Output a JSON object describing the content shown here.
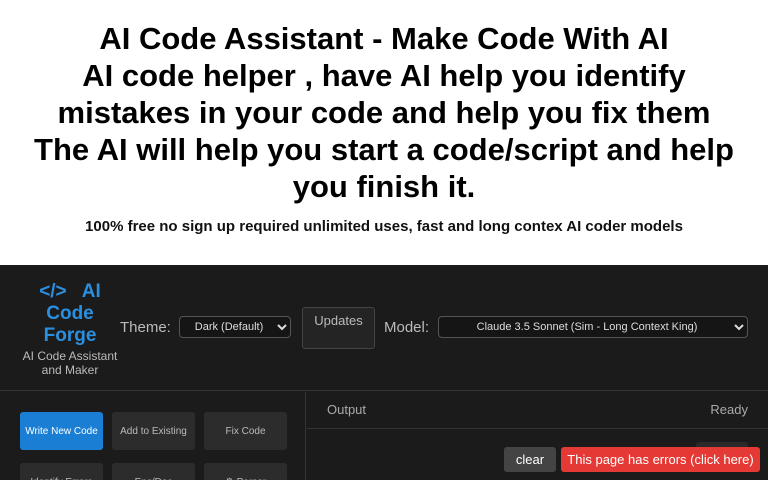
{
  "hero": {
    "title_lines": [
      "AI Code Assistant - Make Code With AI",
      "AI code helper , have AI help you identify",
      "mistakes in your code and help you fix them",
      "The AI will help you start a code/script and help",
      "you finish it."
    ],
    "tagline": "100% free no sign up required unlimited uses, fast and long contex AI coder models"
  },
  "brand": {
    "logo_lines": [
      "</>   AI",
      "Code",
      "Forge"
    ],
    "subtitle": "AI Code Assistant and Maker"
  },
  "toolbar": {
    "theme_label": "Theme:",
    "theme_value": " Dark (Default)",
    "updates_icon": "",
    "updates_label": "Updates",
    "model_label": "Model:",
    "model_value": "Claude 3.5 Sonnet (Sim - Long Context King)"
  },
  "actions": [
    {
      "label": "Write New Code",
      "active": true
    },
    {
      "label": "Add to Existing",
      "active": false
    },
    {
      "label": "Fix Code",
      "active": false
    },
    {
      "label": "Identify Errors",
      "active": false
    },
    {
      "label": " Enc/Dec",
      "active": false
    },
    {
      "label": "⚙ Parser",
      "active": false
    }
  ],
  "output": {
    "title": "Output",
    "status": "Ready"
  },
  "overlay": {
    "clear_label": " clear",
    "error_label": "This page has errors (click here)"
  },
  "colors": {
    "accent": "#1a7fd4",
    "brand": "#2b8fe0",
    "error": "#e53935",
    "app_bg": "#1b1b1b"
  }
}
